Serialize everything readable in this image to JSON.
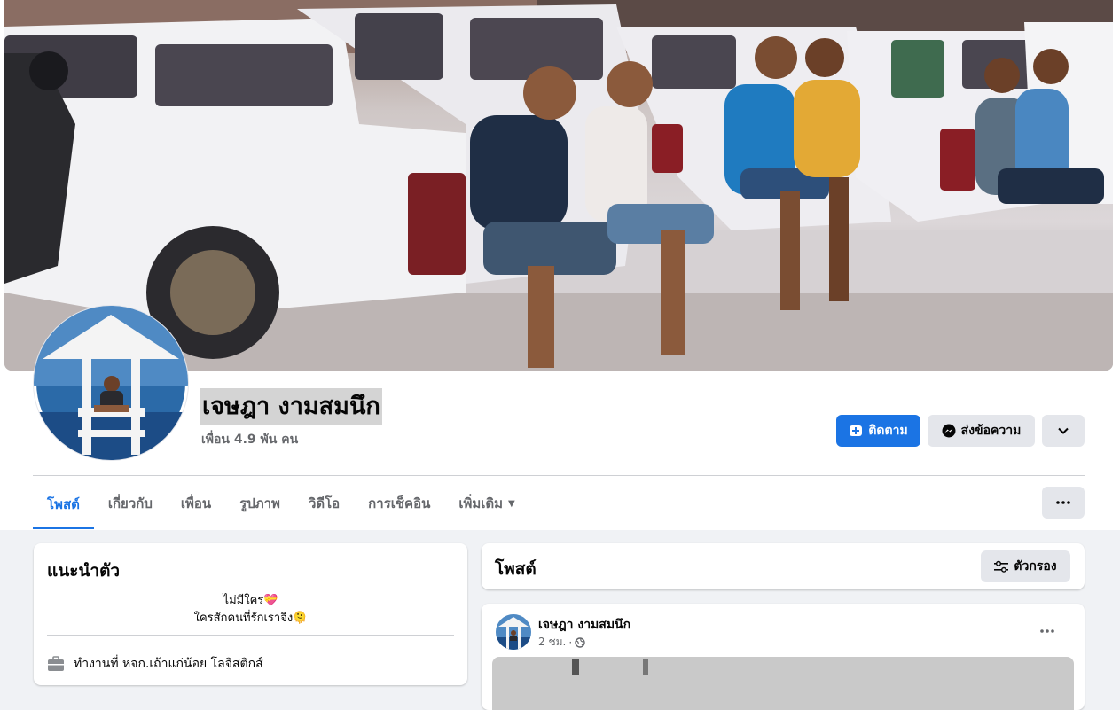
{
  "profile": {
    "name": "เจษฎา งามสมนึก",
    "friends_text": "เพื่อน 4.9 พัน คน"
  },
  "actions": {
    "follow_label": "ติดตาม",
    "message_label": "ส่งข้อความ"
  },
  "tabs": [
    {
      "label": "โพสต์"
    },
    {
      "label": "เกี่ยวกับ"
    },
    {
      "label": "เพื่อน"
    },
    {
      "label": "รูปภาพ"
    },
    {
      "label": "วิดีโอ"
    },
    {
      "label": "การเช็คอิน"
    },
    {
      "label": "เพิ่มเติม"
    }
  ],
  "intro": {
    "title": "แนะนำตัว",
    "bio_line1": "ไม่มีใคร💝",
    "bio_line2": "ใครสักคนที่รักเราจิง🫠",
    "work": "ทำงานที่ หจก.เถ้าแก่น้อย โลจิสติกส์"
  },
  "posts": {
    "title": "โพสต์",
    "filter_label": "ตัวกรอง",
    "items": [
      {
        "author": "เจษฎา งามสมนึก",
        "time": "2 ชม."
      }
    ]
  },
  "colors": {
    "accent": "#1b74e4",
    "button_gray": "#e4e6eb",
    "background": "#f0f2f5",
    "secondary_text": "#65676b"
  },
  "icons": [
    "follow-icon",
    "messenger-icon",
    "chevron-down-icon",
    "more-dots-icon",
    "filter-icon",
    "work-icon",
    "globe-icon"
  ]
}
